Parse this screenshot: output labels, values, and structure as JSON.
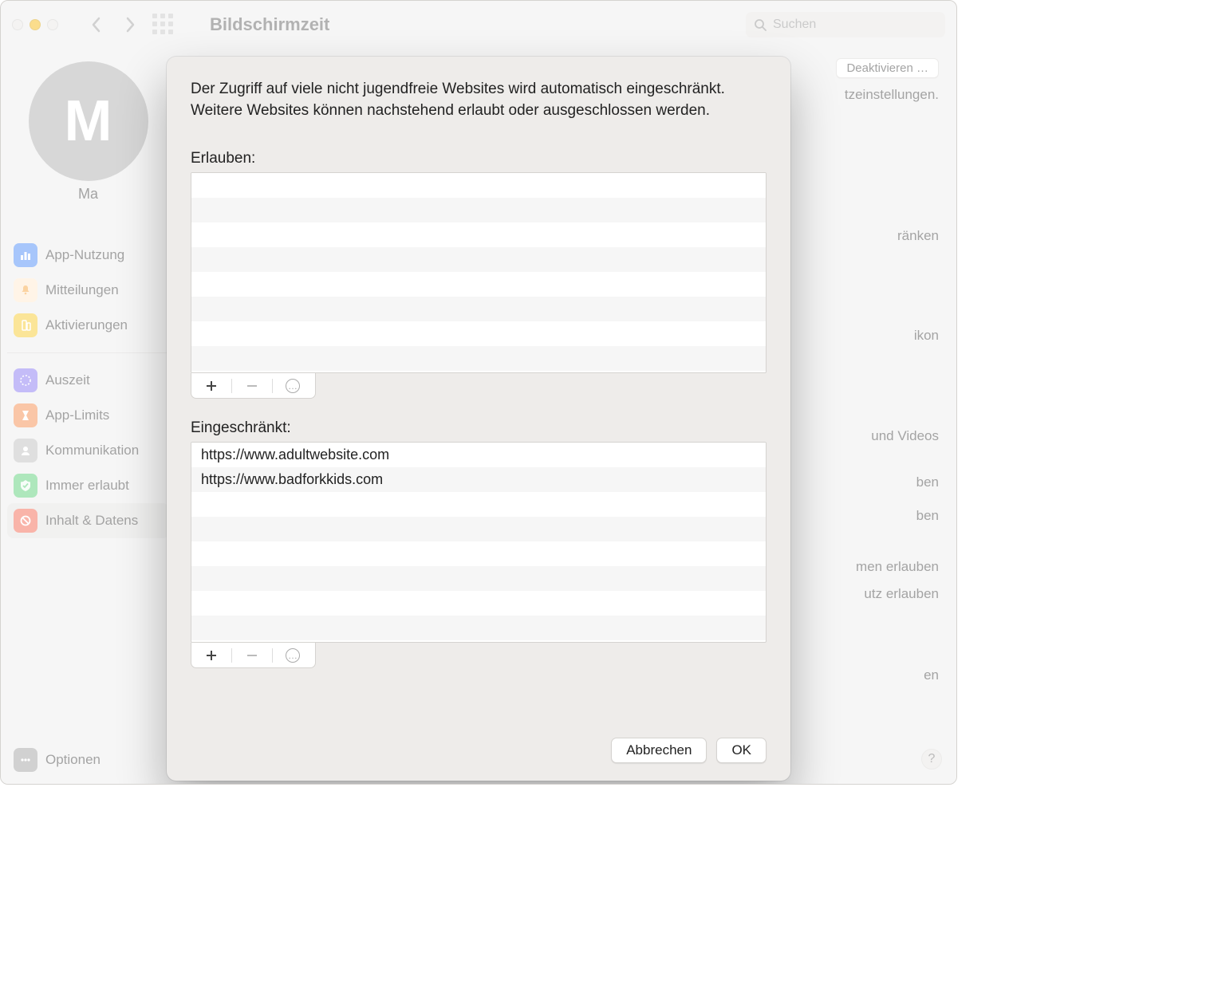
{
  "titlebar": {
    "title": "Bildschirmzeit",
    "search_placeholder": "Suchen"
  },
  "avatar": {
    "initial": "M",
    "name": "Ma"
  },
  "sidebar": {
    "group1": [
      {
        "label": "App-Nutzung",
        "icon": "bars",
        "color": "#3c82f6"
      },
      {
        "label": "Mitteilungen",
        "icon": "bell",
        "color": "#f59d2f"
      },
      {
        "label": "Aktivierungen",
        "icon": "phone",
        "color": "#f7c51b"
      }
    ],
    "group2": [
      {
        "label": "Auszeit",
        "icon": "moon",
        "color": "#7d6bf0"
      },
      {
        "label": "App-Limits",
        "icon": "hourglass",
        "color": "#f4813d"
      },
      {
        "label": "Kommunikation",
        "icon": "users",
        "color": "#b9b9b9"
      },
      {
        "label": "Immer erlaubt",
        "icon": "check",
        "color": "#4cc96a"
      },
      {
        "label": "Inhalt & Datens",
        "icon": "ban",
        "color": "#f25a42"
      }
    ],
    "footer": {
      "label": "Optionen",
      "icon": "dots"
    }
  },
  "content": {
    "btn_deactivate": "Deaktivieren …",
    "sub_settings": "tzeinstellungen.",
    "lines": [
      "ränken",
      "ikon",
      "und Videos",
      "ben",
      "ben",
      "men erlauben",
      "utz erlauben",
      "en"
    ]
  },
  "modal": {
    "intro": "Der Zugriff auf viele nicht jugendfreie Websites wird automatisch eingeschränkt. Weitere Websites können nachstehend erlaubt oder ausgeschlossen werden.",
    "allow_label": "Erlauben:",
    "allow_list": [],
    "restrict_label": "Eingeschränkt:",
    "restrict_list": [
      "https://www.adultwebsite.com",
      "https://www.badforkkids.com"
    ],
    "cancel": "Abbrechen",
    "ok": "OK"
  }
}
